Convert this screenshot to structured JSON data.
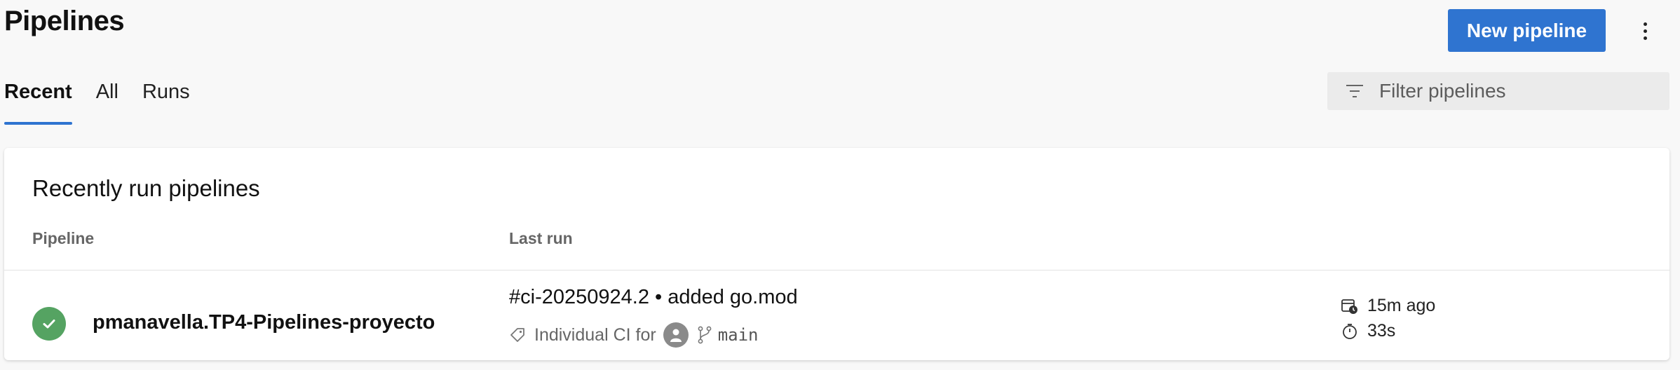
{
  "header": {
    "title": "Pipelines",
    "new_pipeline_label": "New pipeline",
    "more_label": "More actions"
  },
  "tabs": [
    {
      "label": "Recent",
      "active": true
    },
    {
      "label": "All",
      "active": false
    },
    {
      "label": "Runs",
      "active": false
    }
  ],
  "filter": {
    "placeholder": "Filter pipelines"
  },
  "card": {
    "title": "Recently run pipelines",
    "columns": {
      "pipeline": "Pipeline",
      "last_run": "Last run"
    },
    "rows": [
      {
        "status": "succeeded",
        "status_icon": "check-circle-icon",
        "name": "pmanavella.TP4-Pipelines-proyecto",
        "run_title": "#ci-20250924.2 • added go.mod",
        "reason": "Individual CI for",
        "branch": "main",
        "time_ago": "15m ago",
        "duration": "33s"
      }
    ]
  },
  "colors": {
    "accent": "#2f74d0",
    "success": "#55a362",
    "background": "#f8f8f8",
    "card": "#ffffff"
  }
}
